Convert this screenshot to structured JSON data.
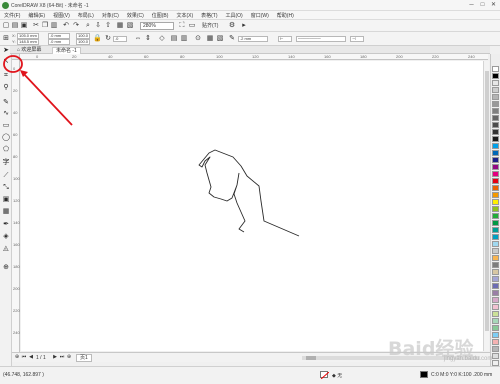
{
  "window": {
    "title": "CorelDRAW X8 (64-Bit) - 未命名 -1",
    "controls": [
      "─",
      "□",
      "✕"
    ]
  },
  "menu": {
    "items": [
      "文件(F)",
      "编辑(E)",
      "视图(V)",
      "布局(L)",
      "对象(C)",
      "效果(C)",
      "位图(B)",
      "文本(X)",
      "表格(T)",
      "工具(O)",
      "窗口(W)",
      "帮助(H)"
    ]
  },
  "toolbar": {
    "zoom_value": "280%",
    "snap_label": "贴齐(T)"
  },
  "propbar": {
    "x_value": "105.0 mm",
    "y_value": "148.5 mm",
    "w_value": ".0 mm",
    "h_value": ".0 mm",
    "scale_x": "100.0",
    "scale_y": "100.0",
    "rotation": ".0",
    "outline_width": ".2 mm"
  },
  "tabs": {
    "home_label": "欢迎屏幕",
    "doc_label": "未命名 -1"
  },
  "ruler": {
    "h_ticks": [
      "0",
      "20",
      "40",
      "60",
      "80",
      "100",
      "120",
      "140",
      "160",
      "180",
      "200",
      "220",
      "240"
    ],
    "v_ticks": [
      "0",
      "20",
      "40",
      "60",
      "80",
      "100",
      "120",
      "140",
      "160",
      "180",
      "200",
      "220",
      "240"
    ]
  },
  "pagenav": {
    "page_count": "1 / 1",
    "page_tab": "页1"
  },
  "status": {
    "coordinates": "(46.748, 162.897 )",
    "fill_label": "无",
    "outline_label": "C:0 M:0 Y:0 K:100  .200 mm"
  },
  "colors": {
    "accent": "#3a8a3a",
    "annotation_red": "#e0141c",
    "palette": [
      "#ffffff",
      "#000000",
      "#e6e6e6",
      "#cccccc",
      "#b3b3b3",
      "#999999",
      "#808080",
      "#666666",
      "#4d4d4d",
      "#333333",
      "#1a1a1a",
      "#00a0e9",
      "#0068b7",
      "#1d2088",
      "#920783",
      "#e4007f",
      "#e60012",
      "#eb6100",
      "#f39800",
      "#fff100",
      "#8fc31f",
      "#22ac38",
      "#009944",
      "#009e96",
      "#00a0c1",
      "#a0d8ef",
      "#c9caca",
      "#f8b551",
      "#7d7d7d",
      "#d8c7a3",
      "#a4a4d4",
      "#6c6cb3",
      "#9a7fa6",
      "#d6a8c8",
      "#f2c1d1",
      "#cce198",
      "#a8d8b9",
      "#89c997",
      "#7ecef4",
      "#f5b2b2",
      "#b5b5b6",
      "#dcdddd",
      "#efefef"
    ]
  },
  "watermark": {
    "main": "Baid经验",
    "sub": "jingyan.baidu.com"
  }
}
